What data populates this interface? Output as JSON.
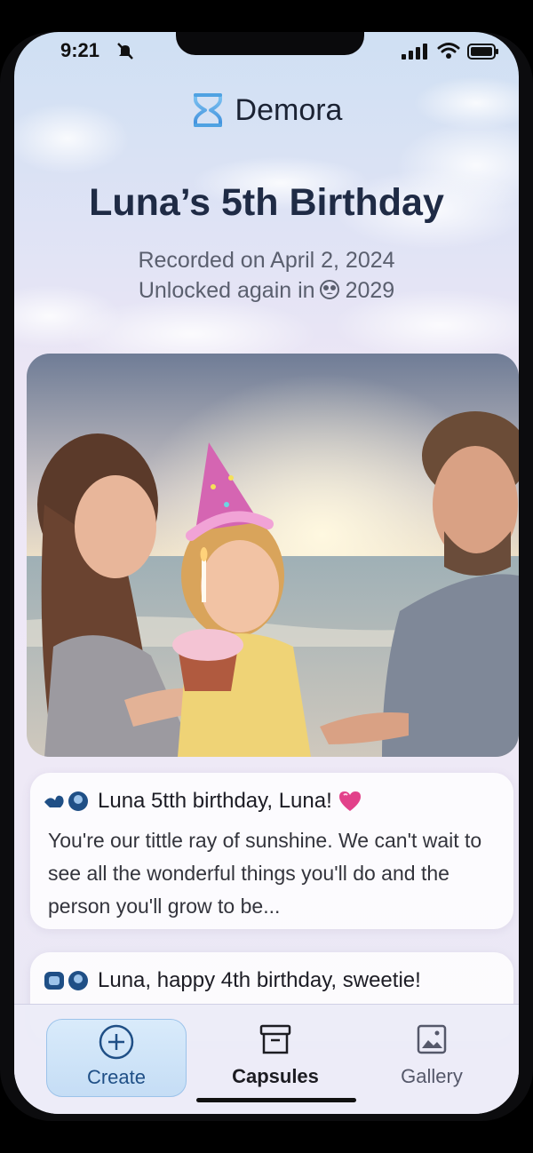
{
  "status_bar": {
    "time": "9:21"
  },
  "app": {
    "name": "Demora"
  },
  "capsule": {
    "title": "Luna’s 5th Birthday",
    "recorded": "Recorded on April 2, 2024",
    "unlocked_prefix": "Unlocked again in",
    "unlocked_year": "2029"
  },
  "photo": {
    "description_icon": "family-birthday-photo"
  },
  "messages": [
    {
      "heading": "Luna 5tth birthday, Luna!",
      "body": "You're our tittle ray of sunshine. We can't wait to see all the wonderful things you'll do and the person you'll grow to be..."
    },
    {
      "heading": "Luna, happy 4th birthday, sweetie!"
    }
  ],
  "tabs": [
    {
      "label": "Create",
      "icon": "plus-circle-icon"
    },
    {
      "label": "Capsules",
      "icon": "archive-box-icon"
    },
    {
      "label": "Gallery",
      "icon": "image-icon"
    }
  ],
  "colors": {
    "accent": "#1f4f86",
    "title": "#1f2b45",
    "heart": "#e2418a"
  }
}
